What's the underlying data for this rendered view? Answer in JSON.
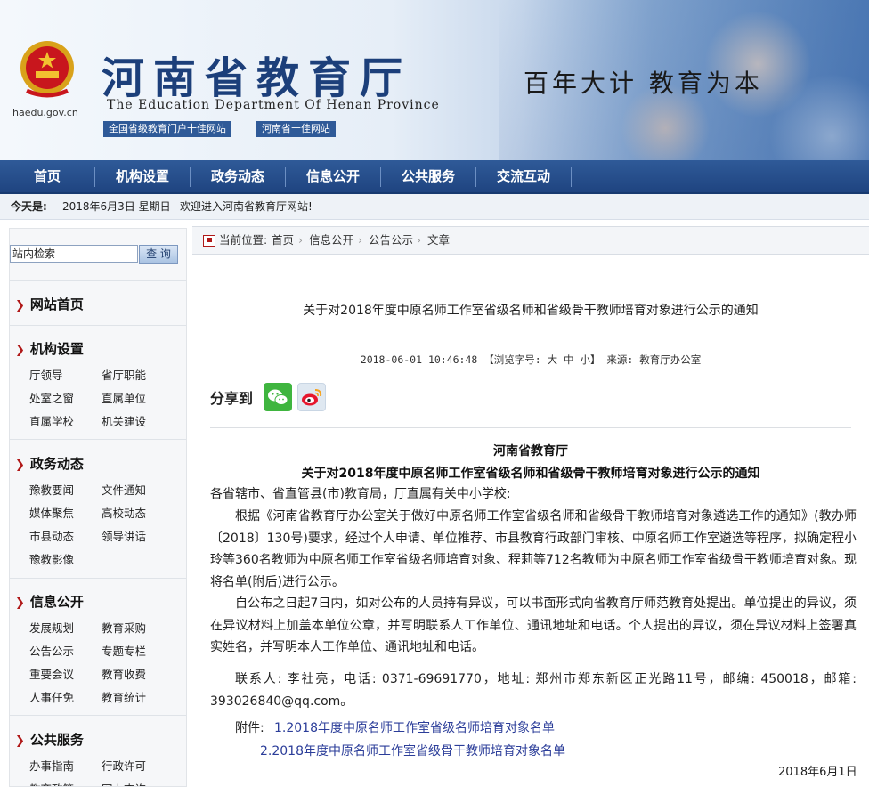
{
  "header": {
    "site_title": "河南省教育厅",
    "site_subtitle": "The Education Department Of Henan Province",
    "domain": "haedu.gov.cn",
    "badges": [
      "全国省级教育门户十佳网站",
      "河南省十佳网站"
    ],
    "slogan": "百年大计 教育为本"
  },
  "nav": {
    "items": [
      "首页",
      "机构设置",
      "政务动态",
      "信息公开",
      "公共服务",
      "交流互动"
    ]
  },
  "datebar": {
    "today_label": "今天是:",
    "date": "2018年6月3日  星期日",
    "welcome": "欢迎进入河南省教育厅网站!"
  },
  "sidebar": {
    "search_value": "站内检索",
    "search_button": "查 询",
    "sections": [
      {
        "title": "网站首页",
        "links": []
      },
      {
        "title": "机构设置",
        "links": [
          "厅领导",
          "省厅职能",
          "处室之窗",
          "直属单位",
          "直属学校",
          "机关建设"
        ]
      },
      {
        "title": "政务动态",
        "links": [
          "豫教要闻",
          "文件通知",
          "媒体聚焦",
          "高校动态",
          "市县动态",
          "领导讲话",
          "豫教影像"
        ]
      },
      {
        "title": "信息公开",
        "links": [
          "发展规划",
          "教育采购",
          "公告公示",
          "专题专栏",
          "重要会议",
          "教育收费",
          "人事任免",
          "教育统计"
        ]
      },
      {
        "title": "公共服务",
        "links": [
          "办事指南",
          "行政许可",
          "教育政策",
          "网上查询"
        ]
      }
    ]
  },
  "breadcrumb": {
    "label": "当前位置:",
    "items": [
      "首页",
      "信息公开",
      "公告公示",
      "文章"
    ],
    "sep": "›"
  },
  "article": {
    "title": "关于对2018年度中原名师工作室省级名师和省级骨干教师培育对象进行公示的通知",
    "meta": "2018-06-01 10:46:48 【浏览字号: 大 中 小】 来源: 教育厅办公室",
    "share_label": "分享到",
    "share_icons": [
      "wechat-icon",
      "weibo-icon"
    ],
    "doc_org": "河南省教育厅",
    "doc_title": "关于对2018年度中原名师工作室省级名师和省级骨干教师培育对象进行公示的通知",
    "salutation": "各省辖市、省直管县(市)教育局，厅直属有关中小学校:",
    "para1": "根据《河南省教育厅办公室关于做好中原名师工作室省级名师和省级骨干教师培育对象遴选工作的通知》(教办师〔2018〕130号)要求，经过个人申请、单位推荐、市县教育行政部门审核、中原名师工作室遴选等程序，拟确定程小玲等360名教师为中原名师工作室省级名师培育对象、程莉等712名教师为中原名师工作室省级骨干教师培育对象。现将名单(附后)进行公示。",
    "para2": "自公布之日起7日内，如对公布的人员持有异议，可以书面形式向省教育厅师范教育处提出。单位提出的异议，须在异议材料上加盖本单位公章，并写明联系人工作单位、通讯地址和电话。个人提出的异议，须在异议材料上签署真实姓名，并写明本人工作单位、通讯地址和电话。",
    "contact": "联系人: 李社亮，电话: 0371-69691770，地址: 郑州市郑东新区正光路11号，邮编: 450018，邮箱: 393026840@qq.com。",
    "attach_label": "附件:",
    "attachments": [
      "1.2018年度中原名师工作室省级名师培育对象名单",
      "2.2018年度中原名师工作室省级骨干教师培育对象名单"
    ],
    "sign_date": "2018年6月1日"
  },
  "colors": {
    "nav_blue": "#2f5a98",
    "title_blue": "#1c3f7a",
    "accent_red": "#b01818",
    "link_blue": "#2b3d99"
  }
}
